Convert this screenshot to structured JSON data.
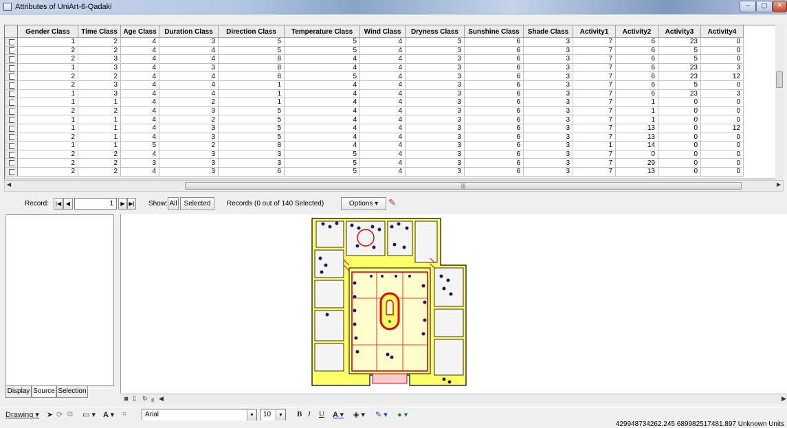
{
  "window": {
    "title": "Attributes of UniArt-6-Qadaki",
    "min_label": "–",
    "max_label": "▢",
    "close_label": "✕"
  },
  "table": {
    "columns": [
      "Gender Class",
      "Time Class",
      "Age Class",
      "Duration Class",
      "Direction Class",
      "Temperature Class",
      "Wind Class",
      "Dryness Class",
      "Sunshine Class",
      "Shade Class",
      "Activity1",
      "Activity2",
      "Activity3",
      "Activity4"
    ],
    "rows": [
      [
        "1",
        "2",
        "4",
        "3",
        "5",
        "5",
        "4",
        "3",
        "6",
        "3",
        "7",
        "6",
        "23",
        "0"
      ],
      [
        "2",
        "2",
        "4",
        "4",
        "5",
        "5",
        "4",
        "3",
        "6",
        "3",
        "7",
        "6",
        "5",
        "0"
      ],
      [
        "2",
        "3",
        "4",
        "4",
        "8",
        "4",
        "4",
        "3",
        "6",
        "3",
        "7",
        "6",
        "5",
        "0"
      ],
      [
        "1",
        "3",
        "4",
        "3",
        "8",
        "4",
        "4",
        "3",
        "6",
        "3",
        "7",
        "6",
        "23",
        "3"
      ],
      [
        "2",
        "2",
        "4",
        "4",
        "8",
        "5",
        "4",
        "3",
        "6",
        "3",
        "7",
        "6",
        "23",
        "12"
      ],
      [
        "2",
        "3",
        "4",
        "4",
        "1",
        "4",
        "4",
        "3",
        "6",
        "3",
        "7",
        "6",
        "5",
        "0"
      ],
      [
        "1",
        "3",
        "4",
        "4",
        "1",
        "4",
        "4",
        "3",
        "6",
        "3",
        "7",
        "6",
        "23",
        "3"
      ],
      [
        "1",
        "1",
        "4",
        "2",
        "1",
        "4",
        "4",
        "3",
        "6",
        "3",
        "7",
        "1",
        "0",
        "0"
      ],
      [
        "2",
        "2",
        "4",
        "3",
        "5",
        "4",
        "4",
        "3",
        "6",
        "3",
        "7",
        "1",
        "0",
        "0"
      ],
      [
        "1",
        "1",
        "4",
        "2",
        "5",
        "4",
        "4",
        "3",
        "6",
        "3",
        "7",
        "1",
        "0",
        "0"
      ],
      [
        "1",
        "1",
        "4",
        "3",
        "5",
        "4",
        "4",
        "3",
        "6",
        "3",
        "7",
        "13",
        "0",
        "12"
      ],
      [
        "2",
        "1",
        "4",
        "3",
        "5",
        "4",
        "4",
        "3",
        "6",
        "3",
        "7",
        "13",
        "0",
        "0"
      ],
      [
        "1",
        "1",
        "5",
        "2",
        "8",
        "4",
        "4",
        "3",
        "6",
        "3",
        "1",
        "14",
        "0",
        "0"
      ],
      [
        "2",
        "2",
        "4",
        "3",
        "3",
        "5",
        "4",
        "3",
        "6",
        "3",
        "7",
        "0",
        "0",
        "0"
      ],
      [
        "2",
        "2",
        "3",
        "3",
        "3",
        "5",
        "4",
        "3",
        "6",
        "3",
        "7",
        "29",
        "0",
        "0"
      ],
      [
        "2",
        "2",
        "4",
        "3",
        "6",
        "5",
        "4",
        "3",
        "6",
        "3",
        "7",
        "13",
        "0",
        "0"
      ]
    ]
  },
  "record_bar": {
    "record_label": "Record:",
    "record_value": "1",
    "show_label": "Show:",
    "all_label": "All",
    "selected_label": "Selected",
    "records_text": "Records (0 out of 140 Selected)",
    "options_label": "Options"
  },
  "toc_tabs": [
    "Display",
    "Source",
    "Selection"
  ],
  "drawing_toolbar": {
    "drawing_label": "Drawing",
    "font_name": "Arial",
    "font_size": "10",
    "bold_label": "B",
    "italic_label": "I",
    "underline_label": "U"
  },
  "status": {
    "coordinates": "429948734262.245  689982517481.897  Unknown Units"
  },
  "colors": {
    "title_gradient": "#b3c8e3",
    "selection_bg": "#ececec",
    "map_yellow": "#ffff66",
    "map_red": "#e00000",
    "map_dots": "#1a1a5e"
  }
}
